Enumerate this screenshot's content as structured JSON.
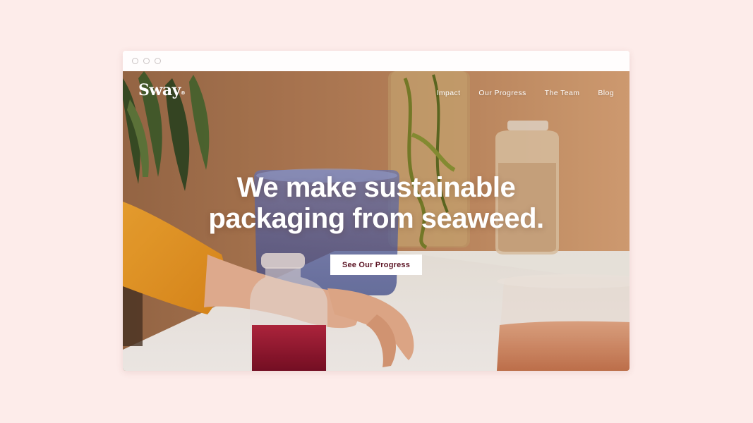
{
  "brand": {
    "logo_text": "Sway",
    "logo_mark": "®"
  },
  "nav": {
    "items": [
      {
        "label": "Impact"
      },
      {
        "label": "Our Progress"
      },
      {
        "label": "The Team"
      },
      {
        "label": "Blog"
      }
    ]
  },
  "hero": {
    "headline_line1": "We make sustainable",
    "headline_line2": "packaging from seaweed.",
    "cta_label": "See Our Progress"
  },
  "colors": {
    "page_background": "#fdecea",
    "cta_text": "#5b1323",
    "sweater": "#f2a52a",
    "liquid_red": "#9c1732"
  },
  "icons": [
    "window-close-dot-icon",
    "window-minimize-dot-icon",
    "window-maximize-dot-icon"
  ]
}
